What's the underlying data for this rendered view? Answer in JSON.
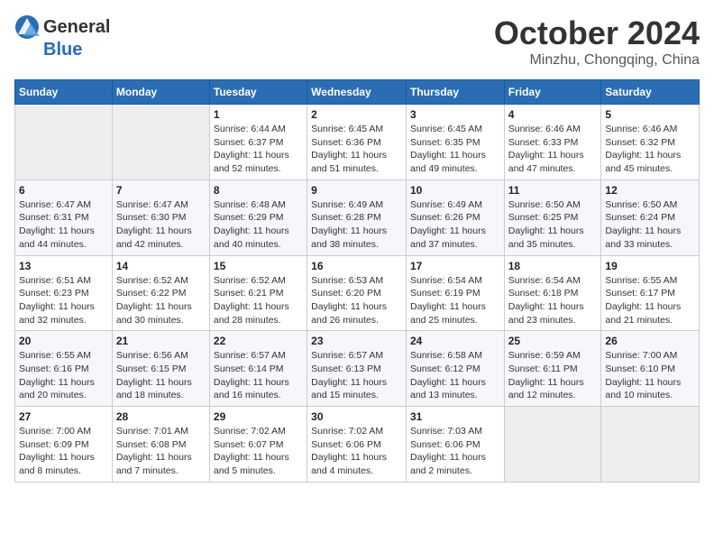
{
  "logo": {
    "general": "General",
    "blue": "Blue"
  },
  "title": {
    "month": "October 2024",
    "location": "Minzhu, Chongqing, China"
  },
  "weekdays": [
    "Sunday",
    "Monday",
    "Tuesday",
    "Wednesday",
    "Thursday",
    "Friday",
    "Saturday"
  ],
  "weeks": [
    [
      {
        "day": "",
        "empty": true
      },
      {
        "day": "",
        "empty": true
      },
      {
        "day": "1",
        "sunrise": "Sunrise: 6:44 AM",
        "sunset": "Sunset: 6:37 PM",
        "daylight": "Daylight: 11 hours and 52 minutes."
      },
      {
        "day": "2",
        "sunrise": "Sunrise: 6:45 AM",
        "sunset": "Sunset: 6:36 PM",
        "daylight": "Daylight: 11 hours and 51 minutes."
      },
      {
        "day": "3",
        "sunrise": "Sunrise: 6:45 AM",
        "sunset": "Sunset: 6:35 PM",
        "daylight": "Daylight: 11 hours and 49 minutes."
      },
      {
        "day": "4",
        "sunrise": "Sunrise: 6:46 AM",
        "sunset": "Sunset: 6:33 PM",
        "daylight": "Daylight: 11 hours and 47 minutes."
      },
      {
        "day": "5",
        "sunrise": "Sunrise: 6:46 AM",
        "sunset": "Sunset: 6:32 PM",
        "daylight": "Daylight: 11 hours and 45 minutes."
      }
    ],
    [
      {
        "day": "6",
        "sunrise": "Sunrise: 6:47 AM",
        "sunset": "Sunset: 6:31 PM",
        "daylight": "Daylight: 11 hours and 44 minutes."
      },
      {
        "day": "7",
        "sunrise": "Sunrise: 6:47 AM",
        "sunset": "Sunset: 6:30 PM",
        "daylight": "Daylight: 11 hours and 42 minutes."
      },
      {
        "day": "8",
        "sunrise": "Sunrise: 6:48 AM",
        "sunset": "Sunset: 6:29 PM",
        "daylight": "Daylight: 11 hours and 40 minutes."
      },
      {
        "day": "9",
        "sunrise": "Sunrise: 6:49 AM",
        "sunset": "Sunset: 6:28 PM",
        "daylight": "Daylight: 11 hours and 38 minutes."
      },
      {
        "day": "10",
        "sunrise": "Sunrise: 6:49 AM",
        "sunset": "Sunset: 6:26 PM",
        "daylight": "Daylight: 11 hours and 37 minutes."
      },
      {
        "day": "11",
        "sunrise": "Sunrise: 6:50 AM",
        "sunset": "Sunset: 6:25 PM",
        "daylight": "Daylight: 11 hours and 35 minutes."
      },
      {
        "day": "12",
        "sunrise": "Sunrise: 6:50 AM",
        "sunset": "Sunset: 6:24 PM",
        "daylight": "Daylight: 11 hours and 33 minutes."
      }
    ],
    [
      {
        "day": "13",
        "sunrise": "Sunrise: 6:51 AM",
        "sunset": "Sunset: 6:23 PM",
        "daylight": "Daylight: 11 hours and 32 minutes."
      },
      {
        "day": "14",
        "sunrise": "Sunrise: 6:52 AM",
        "sunset": "Sunset: 6:22 PM",
        "daylight": "Daylight: 11 hours and 30 minutes."
      },
      {
        "day": "15",
        "sunrise": "Sunrise: 6:52 AM",
        "sunset": "Sunset: 6:21 PM",
        "daylight": "Daylight: 11 hours and 28 minutes."
      },
      {
        "day": "16",
        "sunrise": "Sunrise: 6:53 AM",
        "sunset": "Sunset: 6:20 PM",
        "daylight": "Daylight: 11 hours and 26 minutes."
      },
      {
        "day": "17",
        "sunrise": "Sunrise: 6:54 AM",
        "sunset": "Sunset: 6:19 PM",
        "daylight": "Daylight: 11 hours and 25 minutes."
      },
      {
        "day": "18",
        "sunrise": "Sunrise: 6:54 AM",
        "sunset": "Sunset: 6:18 PM",
        "daylight": "Daylight: 11 hours and 23 minutes."
      },
      {
        "day": "19",
        "sunrise": "Sunrise: 6:55 AM",
        "sunset": "Sunset: 6:17 PM",
        "daylight": "Daylight: 11 hours and 21 minutes."
      }
    ],
    [
      {
        "day": "20",
        "sunrise": "Sunrise: 6:55 AM",
        "sunset": "Sunset: 6:16 PM",
        "daylight": "Daylight: 11 hours and 20 minutes."
      },
      {
        "day": "21",
        "sunrise": "Sunrise: 6:56 AM",
        "sunset": "Sunset: 6:15 PM",
        "daylight": "Daylight: 11 hours and 18 minutes."
      },
      {
        "day": "22",
        "sunrise": "Sunrise: 6:57 AM",
        "sunset": "Sunset: 6:14 PM",
        "daylight": "Daylight: 11 hours and 16 minutes."
      },
      {
        "day": "23",
        "sunrise": "Sunrise: 6:57 AM",
        "sunset": "Sunset: 6:13 PM",
        "daylight": "Daylight: 11 hours and 15 minutes."
      },
      {
        "day": "24",
        "sunrise": "Sunrise: 6:58 AM",
        "sunset": "Sunset: 6:12 PM",
        "daylight": "Daylight: 11 hours and 13 minutes."
      },
      {
        "day": "25",
        "sunrise": "Sunrise: 6:59 AM",
        "sunset": "Sunset: 6:11 PM",
        "daylight": "Daylight: 11 hours and 12 minutes."
      },
      {
        "day": "26",
        "sunrise": "Sunrise: 7:00 AM",
        "sunset": "Sunset: 6:10 PM",
        "daylight": "Daylight: 11 hours and 10 minutes."
      }
    ],
    [
      {
        "day": "27",
        "sunrise": "Sunrise: 7:00 AM",
        "sunset": "Sunset: 6:09 PM",
        "daylight": "Daylight: 11 hours and 8 minutes."
      },
      {
        "day": "28",
        "sunrise": "Sunrise: 7:01 AM",
        "sunset": "Sunset: 6:08 PM",
        "daylight": "Daylight: 11 hours and 7 minutes."
      },
      {
        "day": "29",
        "sunrise": "Sunrise: 7:02 AM",
        "sunset": "Sunset: 6:07 PM",
        "daylight": "Daylight: 11 hours and 5 minutes."
      },
      {
        "day": "30",
        "sunrise": "Sunrise: 7:02 AM",
        "sunset": "Sunset: 6:06 PM",
        "daylight": "Daylight: 11 hours and 4 minutes."
      },
      {
        "day": "31",
        "sunrise": "Sunrise: 7:03 AM",
        "sunset": "Sunset: 6:06 PM",
        "daylight": "Daylight: 11 hours and 2 minutes."
      },
      {
        "day": "",
        "empty": true
      },
      {
        "day": "",
        "empty": true
      }
    ]
  ]
}
